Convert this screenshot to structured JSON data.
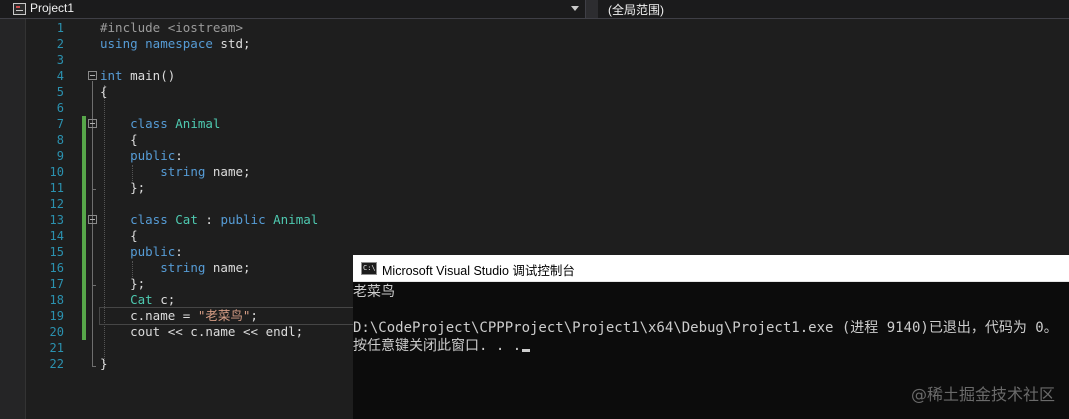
{
  "navbar": {
    "project": "Project1",
    "scope": "(全局范围)"
  },
  "editor": {
    "line_numbers": [
      "1",
      "2",
      "3",
      "4",
      "5",
      "6",
      "7",
      "8",
      "9",
      "10",
      "11",
      "12",
      "13",
      "14",
      "15",
      "16",
      "17",
      "18",
      "19",
      "20",
      "21",
      "22"
    ],
    "lines": [
      [
        {
          "c": "pp",
          "t": "#include <iostream>"
        }
      ],
      [
        {
          "c": "kw",
          "t": "using namespace"
        },
        {
          "c": "tx",
          "t": " std;"
        }
      ],
      [],
      [
        {
          "c": "kw",
          "t": "int"
        },
        {
          "c": "tx",
          "t": " main()"
        }
      ],
      [
        {
          "c": "tx",
          "t": "{"
        }
      ],
      [],
      [
        {
          "c": "tx",
          "t": "    "
        },
        {
          "c": "kw",
          "t": "class"
        },
        {
          "c": "tx",
          "t": " "
        },
        {
          "c": "ty",
          "t": "Animal"
        }
      ],
      [
        {
          "c": "tx",
          "t": "    {"
        }
      ],
      [
        {
          "c": "tx",
          "t": "    "
        },
        {
          "c": "kw",
          "t": "public"
        },
        {
          "c": "tx",
          "t": ":"
        }
      ],
      [
        {
          "c": "tx",
          "t": "        "
        },
        {
          "c": "kw",
          "t": "string"
        },
        {
          "c": "tx",
          "t": " name;"
        }
      ],
      [
        {
          "c": "tx",
          "t": "    };"
        }
      ],
      [],
      [
        {
          "c": "tx",
          "t": "    "
        },
        {
          "c": "kw",
          "t": "class"
        },
        {
          "c": "tx",
          "t": " "
        },
        {
          "c": "ty",
          "t": "Cat"
        },
        {
          "c": "tx",
          "t": " : "
        },
        {
          "c": "kw",
          "t": "public"
        },
        {
          "c": "tx",
          "t": " "
        },
        {
          "c": "ty",
          "t": "Animal"
        }
      ],
      [
        {
          "c": "tx",
          "t": "    {"
        }
      ],
      [
        {
          "c": "tx",
          "t": "    "
        },
        {
          "c": "kw",
          "t": "public"
        },
        {
          "c": "tx",
          "t": ":"
        }
      ],
      [
        {
          "c": "tx",
          "t": "        "
        },
        {
          "c": "kw",
          "t": "string"
        },
        {
          "c": "tx",
          "t": " name;"
        }
      ],
      [
        {
          "c": "tx",
          "t": "    };"
        }
      ],
      [
        {
          "c": "tx",
          "t": "    "
        },
        {
          "c": "ty",
          "t": "Cat"
        },
        {
          "c": "tx",
          "t": " c;"
        }
      ],
      [
        {
          "c": "tx",
          "t": "    c.name = "
        },
        {
          "c": "st",
          "t": "\"老菜鸟\""
        },
        {
          "c": "tx",
          "t": ";"
        }
      ],
      [
        {
          "c": "tx",
          "t": "    cout << c.name << endl;"
        }
      ],
      [],
      [
        {
          "c": "tx",
          "t": "}"
        }
      ]
    ],
    "current_line": 19
  },
  "console": {
    "icon": "console-app-icon",
    "title": "Microsoft Visual Studio 调试控制台",
    "output": [
      "老菜鸟",
      "",
      "D:\\CodeProject\\CPPProject\\Project1\\x64\\Debug\\Project1.exe (进程 9140)已退出，代码为 0。",
      "按任意键关闭此窗口. . ."
    ]
  },
  "watermark": "@稀土掘金技术社区",
  "colors": {
    "background": "#1e1e1e",
    "keyword": "#569cd6",
    "type": "#4ec9b0",
    "string": "#d69d85",
    "preprocessor": "#9b9b9b",
    "line_number": "#2b91af",
    "change_bar": "#57a64a"
  }
}
